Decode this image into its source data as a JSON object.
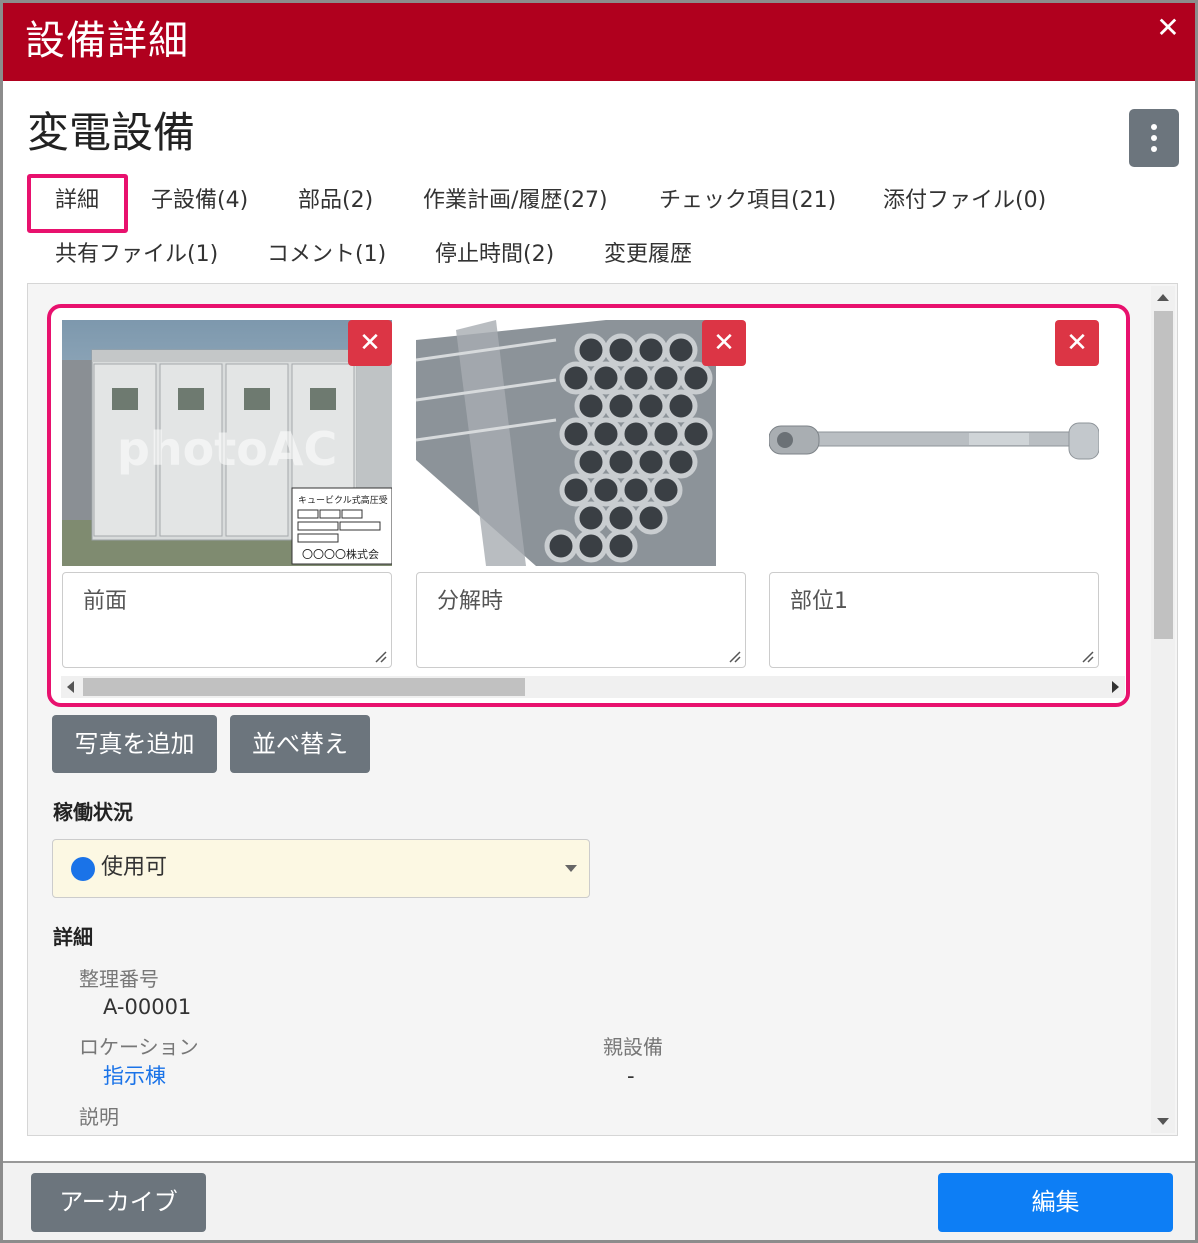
{
  "window": {
    "title": "設備詳細",
    "close_icon": "close-icon"
  },
  "equipment": {
    "name": "変電設備",
    "menu_icon": "kebab-menu-icon"
  },
  "tabs": [
    {
      "label": "詳細",
      "active": true
    },
    {
      "label": "子設備(4)"
    },
    {
      "label": "部品(2)"
    },
    {
      "label": "作業計画/履歴(27)"
    },
    {
      "label": "チェック項目(21)"
    },
    {
      "label": "添付ファイル(0)"
    },
    {
      "label": "共有ファイル(1)"
    },
    {
      "label": "コメント(1)"
    },
    {
      "label": "停止時間(2)"
    },
    {
      "label": "変更履歴"
    }
  ],
  "photos": [
    {
      "caption": "前面",
      "watermark": "photoAC",
      "sign_text": "キュービクル式高圧受",
      "sign_company": "〇〇〇〇株式会"
    },
    {
      "caption": "分解時"
    },
    {
      "caption": "部位1"
    }
  ],
  "photo_actions": {
    "add_label": "写真を追加",
    "sort_label": "並べ替え"
  },
  "status": {
    "label": "稼働状況",
    "value": "使用可",
    "color": "#1a73e8"
  },
  "details": {
    "label": "詳細",
    "management_number_label": "整理番号",
    "management_number": "A-00001",
    "location_label": "ロケーション",
    "location": "指示棟",
    "parent_label": "親設備",
    "parent": "-",
    "description_label": "説明"
  },
  "footer": {
    "archive_label": "アーカイブ",
    "edit_label": "編集"
  },
  "colors": {
    "header": "#b0001e",
    "highlight": "#e8116e",
    "primary": "#0d7ef5",
    "danger": "#dc3545",
    "secondary": "#6c757d"
  }
}
